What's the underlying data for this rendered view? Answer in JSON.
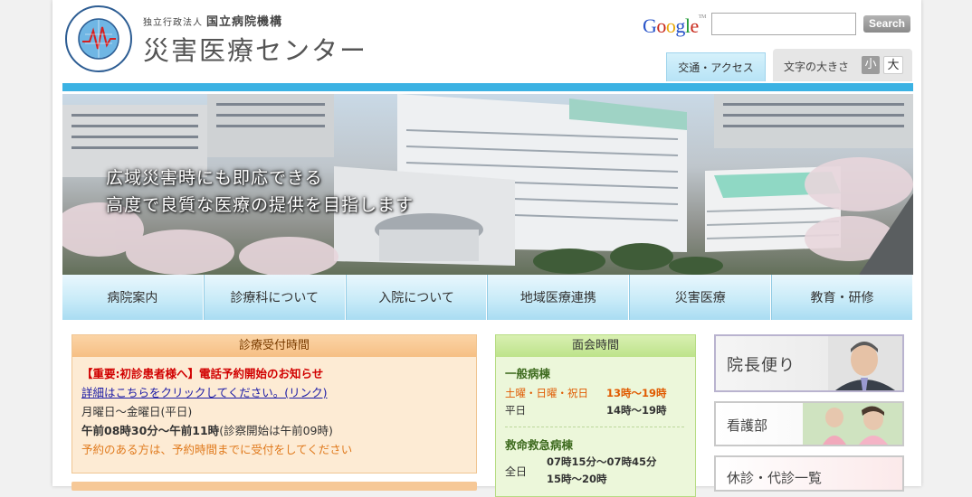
{
  "header": {
    "org_small": "独立行政法人",
    "org_name": "国立病院機構",
    "site_title": "災害医療センター",
    "logo_text": "NATIONAL DISASTER MEDICAL CENTER"
  },
  "search": {
    "brand": "Google",
    "brand_tm": "TM",
    "placeholder": "",
    "button_label": "Search"
  },
  "utility": {
    "access_label": "交通・アクセス",
    "font_size_label": "文字の大きさ",
    "font_small": "小",
    "font_large": "大"
  },
  "hero": {
    "tagline_1": "広域災害時にも即応できる",
    "tagline_2": "高度で良質な医療の提供を目指します"
  },
  "nav": {
    "items": [
      {
        "label": "病院案内"
      },
      {
        "label": "診療科について"
      },
      {
        "label": "入院について"
      },
      {
        "label": "地域医療連携"
      },
      {
        "label": "災害医療"
      },
      {
        "label": "教育・研修"
      }
    ]
  },
  "reception": {
    "title": "診療受付時間",
    "alert": "【重要:初診患者様へ】電話予約開始のお知らせ",
    "link": "詳細はこちらをクリックしてください。(リンク)",
    "days": "月曜日～金曜日(平日)",
    "hours": "午前08時30分～午前11時",
    "hours_note": "(診察開始は午前09時)",
    "note": "予約のある方は、予約時間までに受付をしてください"
  },
  "visiting": {
    "title": "面会時間",
    "general_ward": "一般病棟",
    "rows": [
      {
        "day": "土曜・日曜・祝日",
        "time": "13時～19時",
        "highlight": true
      },
      {
        "day": "平日",
        "time": "14時～19時",
        "highlight": false
      }
    ],
    "emergency_ward": "救命救急病棟",
    "emergency_day": "全日",
    "emergency_times": [
      "07時15分～07時45分",
      "15時～20時"
    ]
  },
  "banners": {
    "director": "院長便り",
    "nursing": "看護部",
    "closure": "休診・代診一覧"
  },
  "colors": {
    "accent_blue": "#3bb2e3",
    "nav_light": "#e9f7fd",
    "reception_orange": "#f6bf84",
    "visiting_green": "#bde38a",
    "alert_red": "#d10000"
  }
}
